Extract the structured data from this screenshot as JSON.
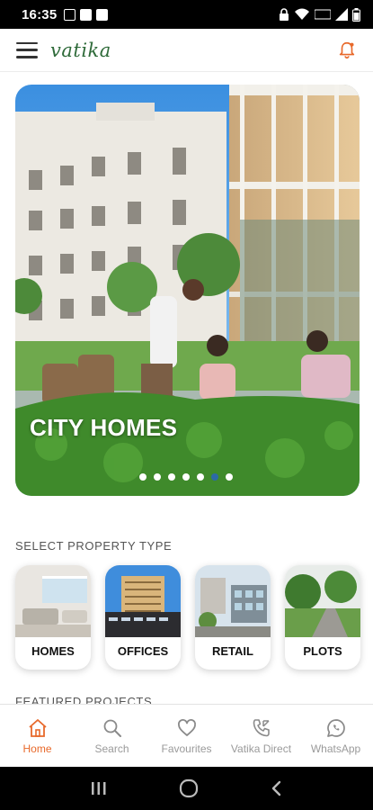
{
  "status_bar": {
    "time": "16:35",
    "left_icons": [
      "notification-d-icon",
      "v-app-icon",
      "gallery-icon"
    ],
    "right_icons": [
      "lock-icon",
      "wifi-icon",
      "volte-icon",
      "signal-icon",
      "battery-icon"
    ]
  },
  "app_bar": {
    "logo_text": "vatika",
    "menu_icon": "hamburger-menu-icon",
    "notification_icon": "bell-icon",
    "accent_color": "#e8692b"
  },
  "hero": {
    "caption": "CITY HOMES",
    "slide_count": 7,
    "active_slide_index": 5
  },
  "property_types": {
    "title": "SELECT PROPERTY TYPE",
    "items": [
      {
        "label": "HOMES"
      },
      {
        "label": "OFFICES"
      },
      {
        "label": "RETAIL"
      },
      {
        "label": "PLOTS"
      }
    ]
  },
  "featured": {
    "title": "FEATURED PROJECTS"
  },
  "bottom_nav": {
    "active_index": 0,
    "items": [
      {
        "label": "Home",
        "icon": "home-icon"
      },
      {
        "label": "Search",
        "icon": "search-icon"
      },
      {
        "label": "Favourites",
        "icon": "heart-icon"
      },
      {
        "label": "Vatika Direct",
        "icon": "phone-call-icon"
      },
      {
        "label": "WhatsApp",
        "icon": "whatsapp-icon"
      }
    ]
  },
  "system_nav": {
    "icons": [
      "recent-apps-icon",
      "home-circle-icon",
      "back-icon"
    ]
  }
}
